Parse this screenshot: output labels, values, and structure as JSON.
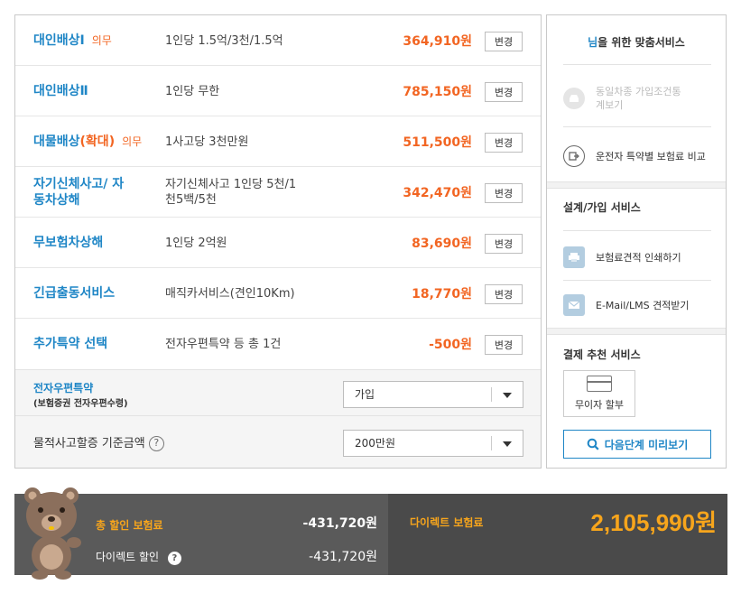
{
  "coverages": [
    {
      "name": "대인배상Ⅰ",
      "required": "의무",
      "desc": "1인당 1.5억/3천/1.5억",
      "price": "364,910원"
    },
    {
      "name": "대인배상Ⅱ",
      "desc": "1인당 무한",
      "price": "785,150원"
    },
    {
      "name": "대물배상",
      "name_extra": "(확대)",
      "required": "의무",
      "desc": "1사고당 3천만원",
      "price": "511,500원"
    },
    {
      "name": "자기신체사고/ 자동차상해",
      "desc": "자기신체사고 1인당 5천/1천5백/5천",
      "price": "342,470원"
    },
    {
      "name": "무보험차상해",
      "desc": "1인당 2억원",
      "price": "83,690원"
    },
    {
      "name": "긴급출동서비스",
      "desc": "매직카서비스(견인10Km)",
      "price": "18,770원"
    },
    {
      "name": "추가특약 선택",
      "desc": "전자우편특약 등 총 1건",
      "price": "-500원"
    }
  ],
  "change_label": "변경",
  "email_option": {
    "title": "전자우편특약",
    "subtitle": "(보험증권 전자우편수령)",
    "value": "가입"
  },
  "property_option": {
    "label": "물적사고할증 기준금액",
    "help": "?",
    "value": "200만원"
  },
  "side": {
    "title_blue": "님",
    "title_rest": "을 위한 맞춤서비스",
    "items_top": [
      {
        "label": "동일차종 가입조건통계보기",
        "icon": "car-icon"
      },
      {
        "label": "운전자 특약별 보험료 비교",
        "icon": "compare-icon"
      }
    ],
    "design_title": "설계/가입 서비스",
    "design_items": [
      {
        "label": "보험료견적 인쇄하기",
        "icon": "printer-icon"
      },
      {
        "label": "E-Mail/LMS 견적받기",
        "icon": "mail-icon"
      }
    ],
    "payment_title": "결제 추천 서비스",
    "installment_label": "무이자 할부",
    "preview_label": "다음단계 미리보기"
  },
  "summary": {
    "total_discount_label": "총 할인 보험료",
    "total_discount_value": "-431,720원",
    "direct_discount_label": "다이렉트 할인",
    "direct_discount_value": "-431,720원",
    "direct_premium_label": "다이렉트 보험료",
    "direct_premium_value": "2,105,990원"
  },
  "colors": {
    "accent_blue": "#1f86c6",
    "accent_orange": "#f26522",
    "premium_yellow": "#f7a51c"
  }
}
